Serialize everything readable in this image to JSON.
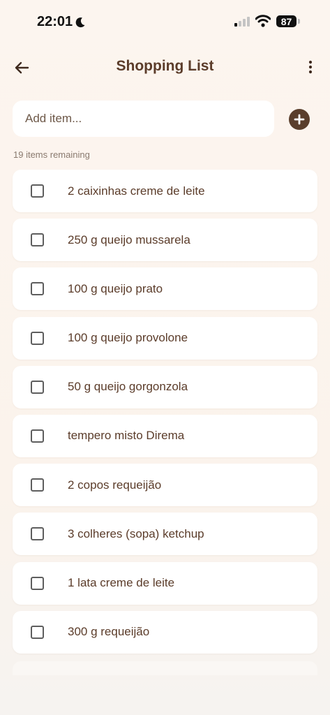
{
  "status_bar": {
    "time": "22:01",
    "battery": "87"
  },
  "header": {
    "title": "Shopping List"
  },
  "add_item": {
    "placeholder": "Add item..."
  },
  "remaining_text": "19 items remaining",
  "items": [
    {
      "label": "2 caixinhas creme de leite",
      "checked": false
    },
    {
      "label": "250 g queijo mussarela",
      "checked": false
    },
    {
      "label": "100 g queijo prato",
      "checked": false
    },
    {
      "label": "100 g queijo provolone",
      "checked": false
    },
    {
      "label": "50 g queijo gorgonzola",
      "checked": false
    },
    {
      "label": "tempero misto Direma",
      "checked": false
    },
    {
      "label": "2 copos requeijão",
      "checked": false
    },
    {
      "label": "3 colheres (sopa) ketchup",
      "checked": false
    },
    {
      "label": "1 lata creme de leite",
      "checked": false
    },
    {
      "label": "300 g requeijão",
      "checked": false
    }
  ]
}
